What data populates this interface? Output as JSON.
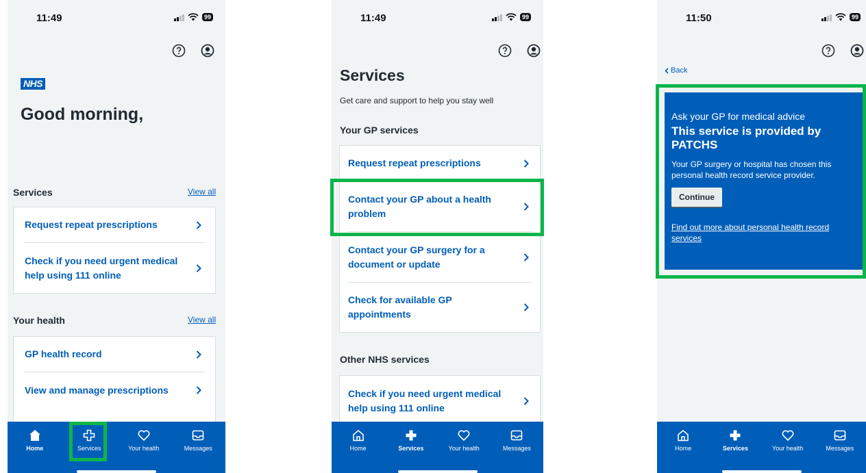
{
  "colors": {
    "nhs_blue": "#005eb8",
    "background": "#f0f4f5",
    "highlight": "#0bb54a"
  },
  "screen1": {
    "time": "11:49",
    "battery": "99",
    "logo": "NHS",
    "greeting": "Good morning,",
    "services_title": "Services",
    "services_view_all": "View all",
    "services_items": [
      "Request repeat prescriptions",
      "Check if you need urgent medical help using 111 online"
    ],
    "health_title": "Your health",
    "health_view_all": "View all",
    "health_items": [
      "GP health record",
      "View and manage prescriptions"
    ]
  },
  "screen2": {
    "time": "11:49",
    "battery": "99",
    "title": "Services",
    "subtitle": "Get care and support to help you stay well",
    "gp_title": "Your GP services",
    "gp_items": [
      "Request repeat prescriptions",
      "Contact your GP about a health problem",
      "Contact your GP surgery for a document or update",
      "Check for available GP appointments"
    ],
    "other_title": "Other NHS services",
    "other_items": [
      "Check if you need urgent medical help using 111 online"
    ]
  },
  "screen3": {
    "time": "11:50",
    "battery": "99",
    "back": "Back",
    "panel_kicker": "Ask your GP for medical advice",
    "panel_title": "This service is provided by PATCHS",
    "panel_body": "Your GP surgery or hospital has chosen this personal health record service provider.",
    "panel_button": "Continue",
    "panel_link": "Find out more about personal health record services"
  },
  "nav": {
    "home": "Home",
    "services": "Services",
    "health": "Your health",
    "messages": "Messages"
  },
  "icons": [
    "help-icon",
    "account-icon",
    "chevron-right-icon",
    "home-icon",
    "services-cross-icon",
    "heart-icon",
    "messages-icon"
  ]
}
